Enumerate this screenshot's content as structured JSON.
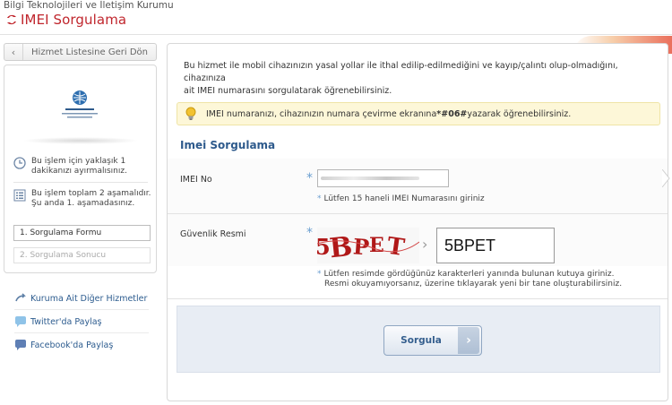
{
  "header": {
    "org_name": "Bilgi Teknolojileri ve İletişim Kurumu",
    "title": "IMEI Sorgulama"
  },
  "sidebar": {
    "back_button": "Hizmet Listesine Geri Dön",
    "info_items": [
      {
        "icon": "clock-icon",
        "text_line1": "Bu işlem için yaklaşık 1",
        "text_line2": "dakikanızı ayırmalısınız."
      },
      {
        "icon": "list-icon",
        "text_line1": "Bu işlem toplam 2 aşamalıdır.",
        "text_line2": "Şu anda 1. aşamadasınız."
      }
    ],
    "steps": [
      {
        "label": "1. Sorgulama Formu",
        "active": true
      },
      {
        "label": "2. Sorgulama Sonucu",
        "active": false
      }
    ],
    "links": [
      {
        "icon": "share-icon",
        "label": "Kuruma Ait Diğer Hizmetler"
      },
      {
        "icon": "twitter-icon",
        "label": "Twitter'da Paylaş"
      },
      {
        "icon": "facebook-icon",
        "label": "Facebook'da Paylaş"
      }
    ]
  },
  "main": {
    "intro_line1": "Bu hizmet ile mobil cihazınızın yasal yollar ile ithal edilip-edilmediğini ve kayıp/çalıntı olup-olmadığını, cihazınıza",
    "intro_line2": "ait IMEI numarasını sorgulatarak öğrenebilirsiniz.",
    "tip_before": "IMEI numaranızı, cihazınızın numara çevirme ekranına ",
    "tip_code": "*#06#",
    "tip_after": " yazarak öğrenebilirsiniz.",
    "section_title": "Imei Sorgulama",
    "imei_label": "IMEI No",
    "imei_hint": "Lütfen 15 haneli IMEI Numarasını giriniz",
    "captcha_label": "Güvenlik Resmi",
    "captcha_image_text": "5BPET",
    "captcha_value": "5BPET",
    "captcha_hint_line1": "Lütfen resimde gördüğünüz karakterleri yanında bulunan kutuya giriniz.",
    "captcha_hint_line2": "Resmi okuyamıyorsanız, üzerine tıklayarak yeni bir tane oluşturabilirsiniz.",
    "submit_label": "Sorgula"
  },
  "colors": {
    "brand_red": "#c0262d",
    "link_blue": "#2d5c8f",
    "section_blue": "#2e5a8c",
    "tip_bg": "#fdf7d8"
  }
}
